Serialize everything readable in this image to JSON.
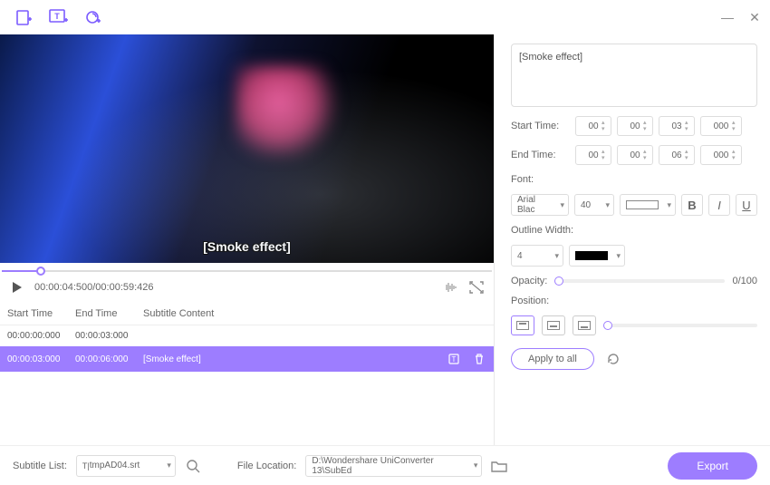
{
  "titlebar_icons": [
    "add-file-icon",
    "add-text-icon",
    "record-icon"
  ],
  "preview": {
    "subtitle_text": "[Smoke effect]"
  },
  "playback": {
    "current_time": "00:00:04:500",
    "total_time": "00:00:59:426"
  },
  "subtitle_table": {
    "headers": {
      "start": "Start Time",
      "end": "End Time",
      "content": "Subtitle Content"
    },
    "rows": [
      {
        "start": "00:00:00:000",
        "end": "00:00:03:000",
        "content": "",
        "selected": false
      },
      {
        "start": "00:00:03:000",
        "end": "00:00:06:000",
        "content": "[Smoke effect]",
        "selected": true
      }
    ]
  },
  "editor": {
    "text": "[Smoke effect]",
    "start_label": "Start Time:",
    "end_label": "End Time:",
    "start_time": {
      "h": "00",
      "m": "00",
      "s": "03",
      "ms": "000"
    },
    "end_time": {
      "h": "00",
      "m": "00",
      "s": "06",
      "ms": "000"
    },
    "font_label": "Font:",
    "font_family": "Arial Blac",
    "font_size": "40",
    "font_color": "#ffffff",
    "outline_label": "Outline Width:",
    "outline_width": "4",
    "outline_color": "#000000",
    "opacity_label": "Opacity:",
    "opacity_value": "0/100",
    "position_label": "Position:",
    "apply_label": "Apply to all"
  },
  "footer": {
    "subtitle_list_label": "Subtitle List:",
    "subtitle_file": "tmpAD04.srt",
    "file_location_label": "File Location:",
    "file_location": "D:\\Wondershare UniConverter 13\\SubEd",
    "export_label": "Export"
  }
}
